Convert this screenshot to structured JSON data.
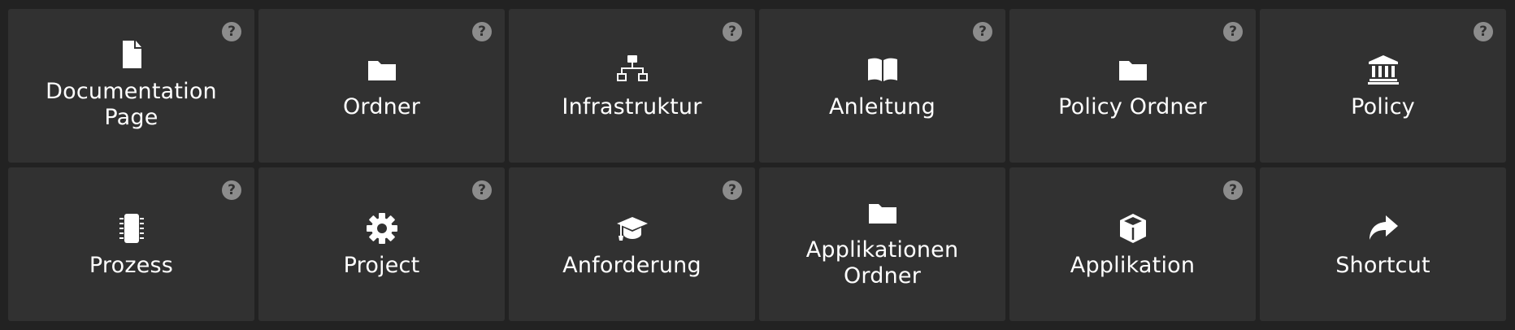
{
  "help_glyph": "?",
  "tiles": [
    {
      "label": "Documentation Page",
      "icon": "file-icon",
      "help": true
    },
    {
      "label": "Ordner",
      "icon": "folder-icon",
      "help": true
    },
    {
      "label": "Infrastruktur",
      "icon": "sitemap-icon",
      "help": true
    },
    {
      "label": "Anleitung",
      "icon": "book-open-icon",
      "help": true
    },
    {
      "label": "Policy Ordner",
      "icon": "folder-icon",
      "help": true
    },
    {
      "label": "Policy",
      "icon": "landmark-icon",
      "help": true
    },
    {
      "label": "Prozess",
      "icon": "microchip-icon",
      "help": true
    },
    {
      "label": "Project",
      "icon": "gear-icon",
      "help": true
    },
    {
      "label": "Anforderung",
      "icon": "graduation-cap-icon",
      "help": true
    },
    {
      "label": "Applikationen Ordner",
      "icon": "folder-icon",
      "help": false
    },
    {
      "label": "Applikation",
      "icon": "cube-icon",
      "help": true
    },
    {
      "label": "Shortcut",
      "icon": "share-arrow-icon",
      "help": false
    }
  ]
}
